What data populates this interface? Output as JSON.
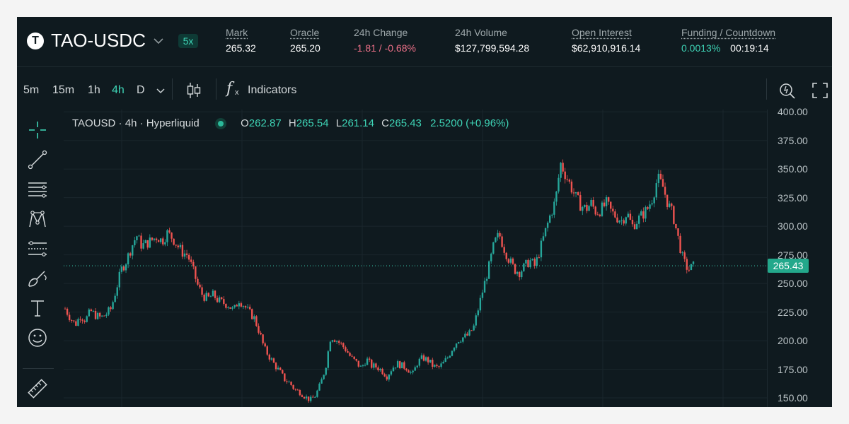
{
  "header": {
    "logo_letter": "T",
    "pair": "TAO-USDC",
    "leverage": "5x",
    "stats": [
      {
        "label": "Mark",
        "value": "265.32",
        "underline": true,
        "tone": "white"
      },
      {
        "label": "Oracle",
        "value": "265.20",
        "underline": true,
        "tone": "white"
      },
      {
        "label": "24h Change",
        "value": "-1.81 / -0.68%",
        "underline": false,
        "tone": "red"
      },
      {
        "label": "24h Volume",
        "value": "$127,799,594.28",
        "underline": false,
        "tone": "white"
      },
      {
        "label": "Open Interest",
        "value": "$62,910,916.14",
        "underline": true,
        "tone": "white"
      }
    ],
    "funding": {
      "label": "Funding / Countdown",
      "rate": "0.0013%",
      "countdown": "00:19:14"
    }
  },
  "toolbar": {
    "timeframes": [
      "5m",
      "15m",
      "1h",
      "4h",
      "D"
    ],
    "active_timeframe": "4h",
    "indicators_label": "Indicators",
    "fx_label": "f"
  },
  "legend": {
    "symbol": "TAOUSD · 4h · Hyperliquid",
    "open_key": "O",
    "open": "262.87",
    "high_key": "H",
    "high": "265.54",
    "low_key": "L",
    "low": "261.14",
    "close_key": "C",
    "close": "265.43",
    "change": "2.5200 (+0.96%)"
  },
  "colors": {
    "up": "#26a69a",
    "down": "#ef5350",
    "accent": "#3ed3b5",
    "background": "#0f1a1f"
  },
  "tools": [
    "crosshair-icon",
    "trend-line-icon",
    "horizontal-lines-icon",
    "pattern-icon",
    "fib-icon",
    "brush-icon",
    "text-tool-icon",
    "emoji-icon",
    "ruler-icon"
  ],
  "chart_data": {
    "type": "candlestick",
    "symbol": "TAOUSD",
    "interval": "4h",
    "y_ticks": [
      "400.00",
      "375.00",
      "350.00",
      "325.00",
      "300.00",
      "275.00",
      "250.00",
      "225.00",
      "200.00",
      "175.00",
      "150.00"
    ],
    "ylim": [
      142,
      402
    ],
    "last_price": "265.43",
    "last_price_value": 265.43,
    "close_path": [
      228,
      220,
      214,
      222,
      218,
      226,
      222,
      220,
      223,
      228,
      245,
      262,
      270,
      282,
      292,
      283,
      285,
      288,
      291,
      287,
      294,
      290,
      283,
      277,
      275,
      262,
      248,
      239,
      237,
      240,
      235,
      233,
      231,
      226,
      236,
      231,
      225,
      220,
      208,
      193,
      186,
      179,
      173,
      166,
      163,
      157,
      155,
      151,
      148,
      152,
      162,
      177,
      204,
      201,
      197,
      192,
      185,
      181,
      176,
      184,
      178,
      177,
      174,
      169,
      176,
      180,
      178,
      176,
      170,
      181,
      185,
      183,
      178,
      176,
      180,
      186,
      195,
      201,
      203,
      205,
      212,
      230,
      248,
      265,
      285,
      293,
      280,
      270,
      262,
      260,
      265,
      270,
      265,
      280,
      295,
      310,
      322,
      355,
      345,
      335,
      325,
      318,
      315,
      320,
      312,
      315,
      320,
      312,
      308,
      305,
      312,
      300,
      305,
      310,
      315,
      325,
      342,
      335,
      320,
      310,
      290,
      270,
      262,
      265
    ],
    "grid": true,
    "price_line": "dotted"
  }
}
